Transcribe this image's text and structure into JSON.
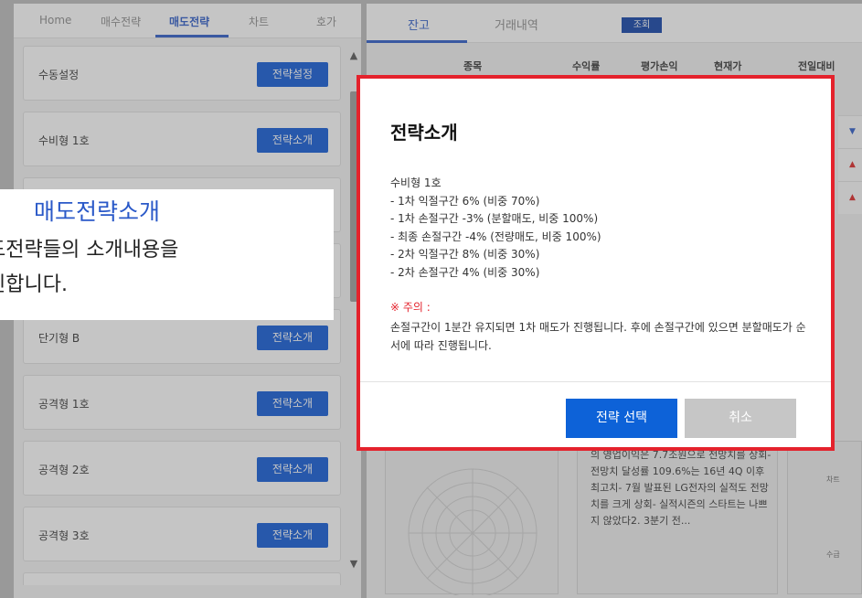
{
  "left_tabs": [
    "Home",
    "매수전략",
    "매도전략",
    "차트",
    "호가"
  ],
  "strategies": [
    {
      "name": "수동설정",
      "button": "전략설정"
    },
    {
      "name": "수비형 1호",
      "button": "전략소개"
    },
    {
      "name": "",
      "button": ""
    },
    {
      "name": "",
      "button": ""
    },
    {
      "name": "단기형 B",
      "button": "전략소개"
    },
    {
      "name": "공격형 1호",
      "button": "전략소개"
    },
    {
      "name": "공격형 2호",
      "button": "전략소개"
    },
    {
      "name": "공격형 3호",
      "button": "전략소개"
    }
  ],
  "right_tabs": [
    "잔고",
    "거래내역"
  ],
  "query_button": "조회",
  "table_headers": [
    "종목",
    "수익률",
    "평가손익",
    "현재가",
    "전일대비"
  ],
  "row_markers": [
    "▼",
    "▲",
    "▲"
  ],
  "news_text": "의 영업이익은 7.7조원으로 전망치를 상회- 전망치 달성률 109.6%는 16년 4Q 이후 최고치- 7월 발표된 LG전자의 실적도 전망치를 크게 상회- 실적시즌의 스타트는 나쁘지 않았다2. 3분기 전...",
  "side_labels": [
    "차트",
    "수급"
  ],
  "callout": {
    "title": "매도전략소개",
    "desc_line1": "도전략들의 소개내용을",
    "desc_line2": "인합니다."
  },
  "modal": {
    "title": "전략소개",
    "body_lines": [
      "수비형 1호",
      "- 1차 익절구간 6% (비중 70%)",
      "- 1차 손절구간 -3% (분할매도, 비중 100%)",
      "- 최종 손절구간 -4% (전량매도, 비중 100%)",
      "- 2차 익절구간 8% (비중 30%)",
      "- 2차 손절구간 4% (비중 30%)"
    ],
    "notice_title": "※ 주의 :",
    "notice_body": "손절구간이 1분간 유지되면 1차 매도가 진행됩니다. 후에 손절구간에 있으면 분할매도가 순서에 따라 진행됩니다.",
    "select_button": "전략 선택",
    "cancel_button": "취소"
  },
  "colors": {
    "accent": "#2a59c8",
    "primary_button": "#0d58d8",
    "highlight_border": "#e4222c"
  }
}
